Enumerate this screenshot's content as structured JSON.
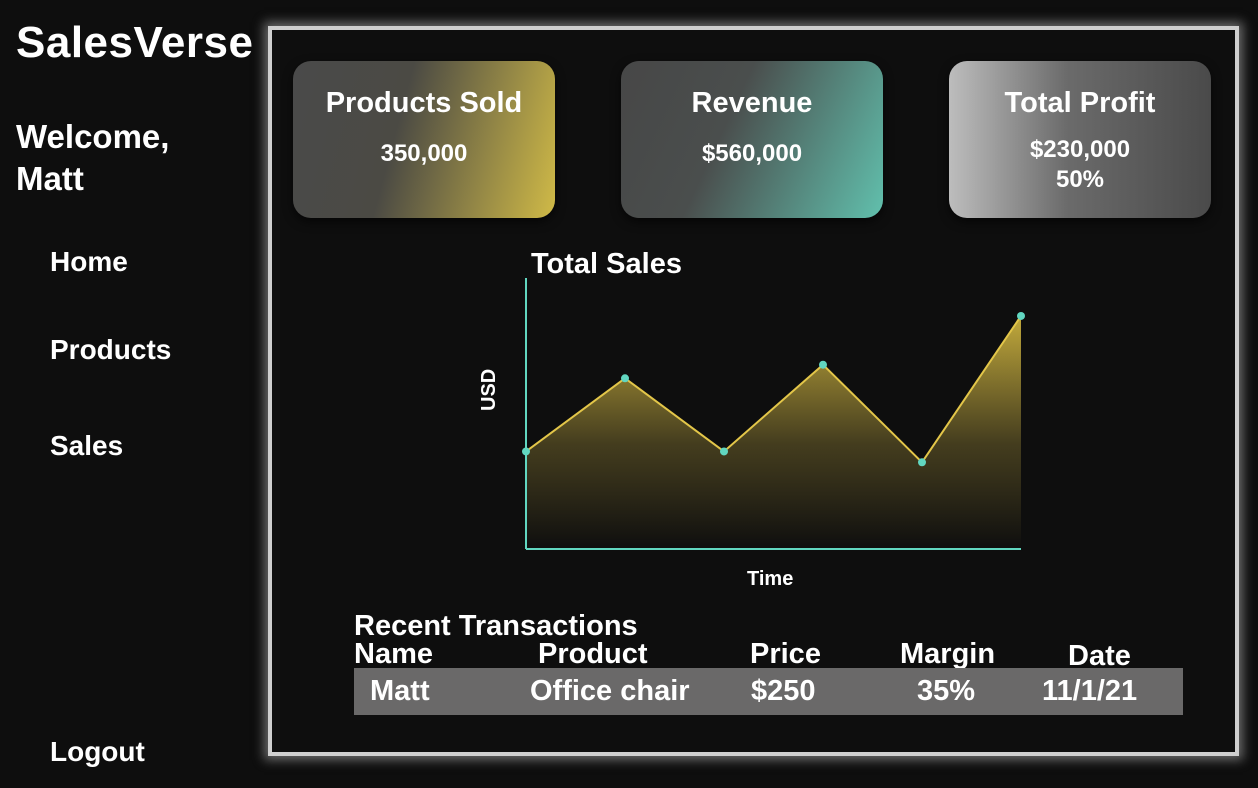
{
  "app": {
    "title": "SalesVerse"
  },
  "sidebar": {
    "welcome": "Welcome,",
    "user": "Matt",
    "items": [
      {
        "label": "Home"
      },
      {
        "label": "Products"
      },
      {
        "label": "Sales"
      }
    ],
    "logout": "Logout"
  },
  "cards": {
    "products_sold": {
      "title": "Products Sold",
      "value": "350,000"
    },
    "revenue": {
      "title": "Revenue",
      "value": "$560,000"
    },
    "total_profit": {
      "title": "Total Profit",
      "value": "$230,000",
      "sub": "50%"
    }
  },
  "chart_data": {
    "type": "area",
    "title": "Total Sales",
    "xlabel": "Time",
    "ylabel": "USD",
    "values": [
      0.36,
      0.63,
      0.36,
      0.68,
      0.32,
      0.86
    ],
    "ylim": [
      0,
      1
    ],
    "grid": false,
    "colors": {
      "line": "#e3c649",
      "marker": "#61d6c0",
      "axis": "#61d6c0"
    }
  },
  "transactions": {
    "title": "Recent Transactions",
    "columns": [
      "Name",
      "Product",
      "Price",
      "Margin",
      "Date"
    ],
    "rows": [
      [
        "Matt",
        "Office chair",
        "$250",
        "35%",
        "11/1/21"
      ]
    ]
  }
}
